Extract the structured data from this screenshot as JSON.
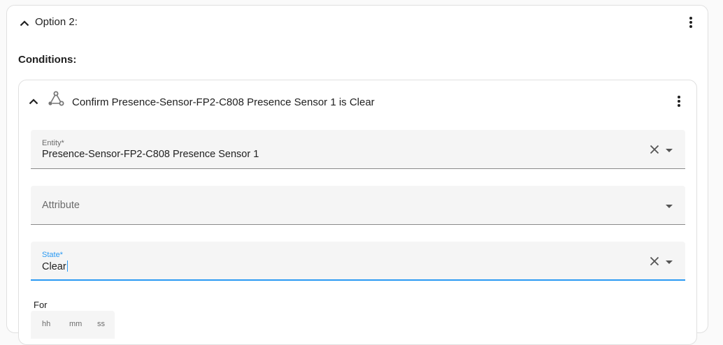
{
  "option": {
    "title": "Option 2:",
    "chevron_icon": "chevron-up-icon",
    "menu_icon": "dots-vertical-icon"
  },
  "conditions": {
    "label": "Conditions:"
  },
  "condition": {
    "title": "Confirm Presence-Sensor-FP2-C808 Presence Sensor 1 is Clear",
    "type_icon": "state-condition-icon",
    "fields": {
      "entity": {
        "label": "Entity*",
        "value": "Presence-Sensor-FP2-C808 Presence Sensor 1"
      },
      "attribute": {
        "label": "Attribute",
        "value": ""
      },
      "state": {
        "label": "State*",
        "value": "Clear"
      }
    },
    "for": {
      "label": "For",
      "units": [
        "hh",
        "mm",
        "ss"
      ]
    }
  },
  "colors": {
    "accent": "#2b9af3",
    "field_bg": "#f5f5f5",
    "border": "#e0e0e0"
  }
}
